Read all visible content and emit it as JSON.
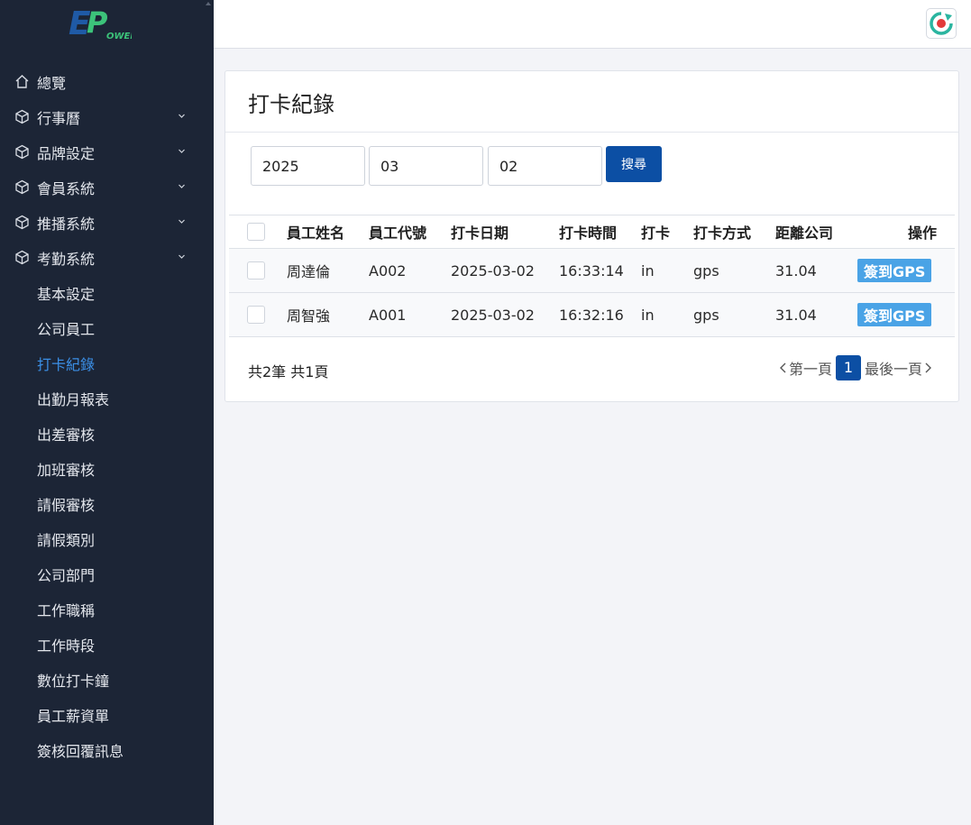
{
  "app": {
    "logo_text_e": "E",
    "logo_text_p": "P",
    "logo_text_ower": "OWER",
    "brand_blue": "#1f5aa6",
    "brand_green": "#3cc37a"
  },
  "sidebar": {
    "items": [
      {
        "label": "總覽",
        "icon": "home-icon"
      },
      {
        "label": "行事曆",
        "icon": "cube-icon"
      },
      {
        "label": "品牌設定",
        "icon": "cube-icon"
      },
      {
        "label": "會員系統",
        "icon": "cube-icon"
      },
      {
        "label": "推播系統",
        "icon": "cube-icon"
      },
      {
        "label": "考勤系統",
        "icon": "cube-icon"
      }
    ],
    "sub_items": [
      {
        "label": "基本設定"
      },
      {
        "label": "公司員工"
      },
      {
        "label": "打卡紀錄"
      },
      {
        "label": "出勤月報表"
      },
      {
        "label": "出差審核"
      },
      {
        "label": "加班審核"
      },
      {
        "label": "請假審核"
      },
      {
        "label": "請假類別"
      },
      {
        "label": "公司部門"
      },
      {
        "label": "工作職稱"
      },
      {
        "label": "工作時段"
      },
      {
        "label": "數位打卡鐘"
      },
      {
        "label": "員工薪資單"
      },
      {
        "label": "簽核回覆訊息"
      }
    ]
  },
  "page": {
    "title": "打卡紀錄",
    "search": {
      "year": "2025",
      "month": "03",
      "day": "02",
      "button_label": "搜尋"
    },
    "table": {
      "headers": [
        "員工姓名",
        "員工代號",
        "打卡日期",
        "打卡時間",
        "打卡",
        "打卡方式",
        "距離公司",
        "操作"
      ],
      "rows": [
        {
          "name": "周達倫",
          "code": "A002",
          "date": "2025-03-02",
          "time": "16:33:14",
          "punch": "in",
          "method": "gps",
          "distance": "31.04",
          "action": "簽到GPS"
        },
        {
          "name": "周智強",
          "code": "A001",
          "date": "2025-03-02",
          "time": "16:32:16",
          "punch": "in",
          "method": "gps",
          "distance": "31.04",
          "action": "簽到GPS"
        }
      ]
    },
    "summary": "共2筆 共1頁",
    "pagination": {
      "first": "第一頁",
      "current": "1",
      "last": "最後一頁"
    }
  }
}
